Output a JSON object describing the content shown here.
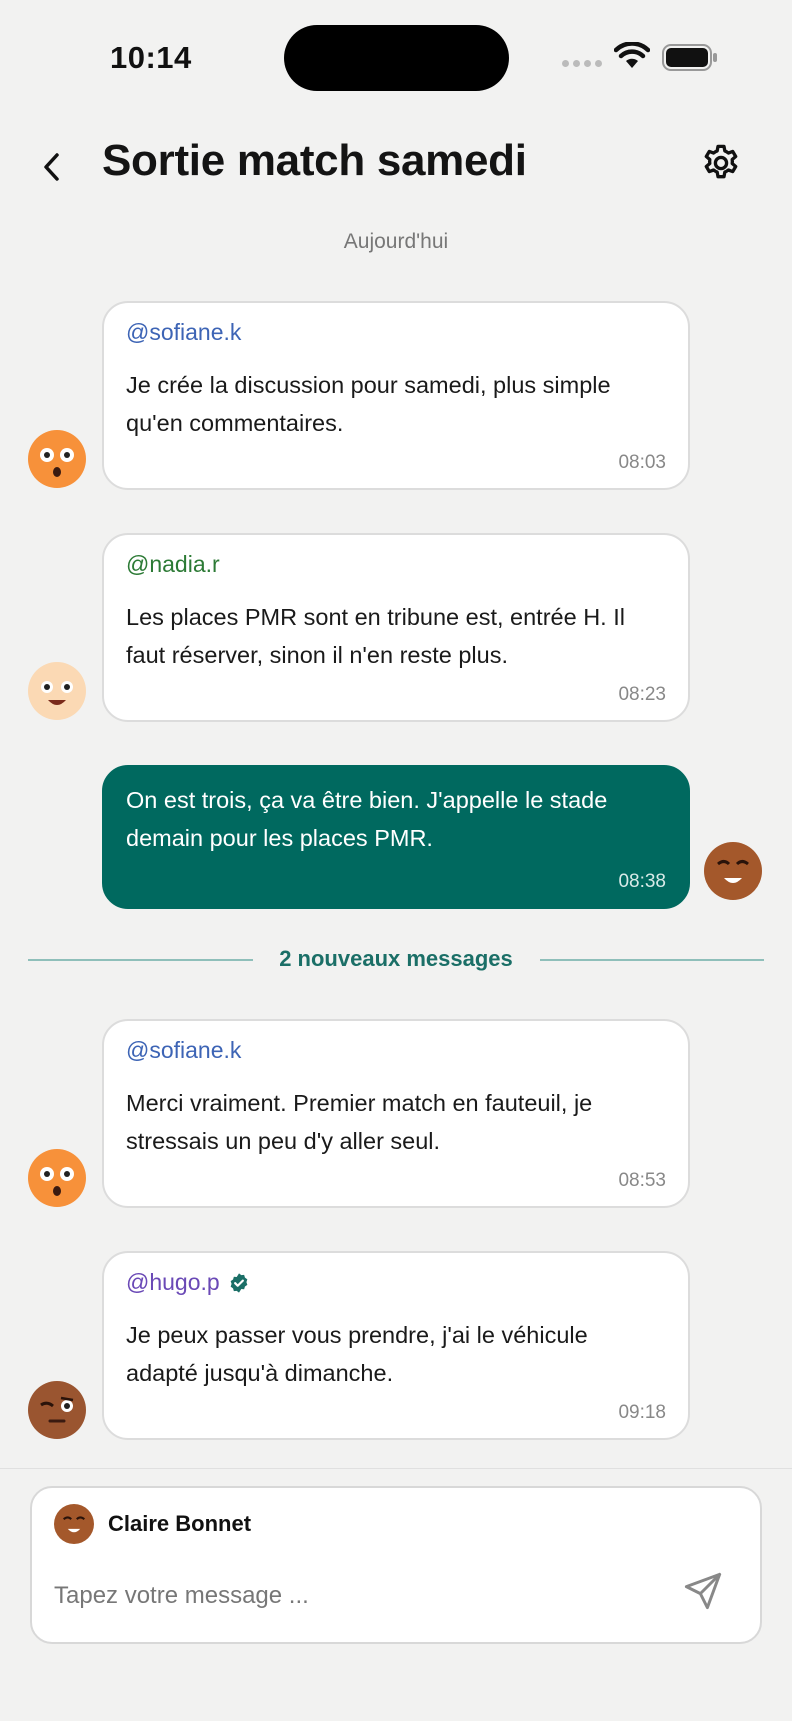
{
  "status": {
    "time": "10:14"
  },
  "header": {
    "title": "Sortie match samedi"
  },
  "date_separator": "Aujourd'hui",
  "messages": [
    {
      "author": "@sofiane.k",
      "text": "Je crée la discussion pour samedi, plus simple qu'en commentaires.",
      "time": "08:03",
      "mine": false,
      "verified": false
    },
    {
      "author": "@nadia.r",
      "text": "Les places PMR sont en tribune est, entrée H. Il faut réserver, sinon il n'en reste plus.",
      "time": "08:23",
      "mine": false,
      "verified": false
    },
    {
      "author": "",
      "text": "On est trois, ça va être bien. J'appelle le stade demain pour les places PMR.",
      "time": "08:38",
      "mine": true,
      "verified": false
    },
    {
      "author": "@sofiane.k",
      "text": "Merci vraiment. Premier match en fauteuil, je stressais un peu d'y aller seul.",
      "time": "08:53",
      "mine": false,
      "verified": false
    },
    {
      "author": "@hugo.p",
      "text": "Je peux passer vous prendre, j'ai le véhicule adapté jusqu'à dimanche.",
      "time": "09:18",
      "mine": false,
      "verified": true
    }
  ],
  "new_messages_label": "2 nouveaux messages",
  "composer": {
    "sender_name": "Claire Bonnet",
    "placeholder": "Tapez votre message ..."
  },
  "colors": {
    "accent": "#00695f",
    "background": "#f2f2f1",
    "handle_sofiane": "#3d64b5",
    "handle_nadia": "#2c7a35",
    "handle_hugo": "#6a49b6"
  },
  "icons": [
    "back-chevron-icon",
    "settings-gear-icon",
    "verified-badge-icon",
    "send-icon",
    "wifi-icon",
    "battery-icon",
    "signal-icon"
  ]
}
